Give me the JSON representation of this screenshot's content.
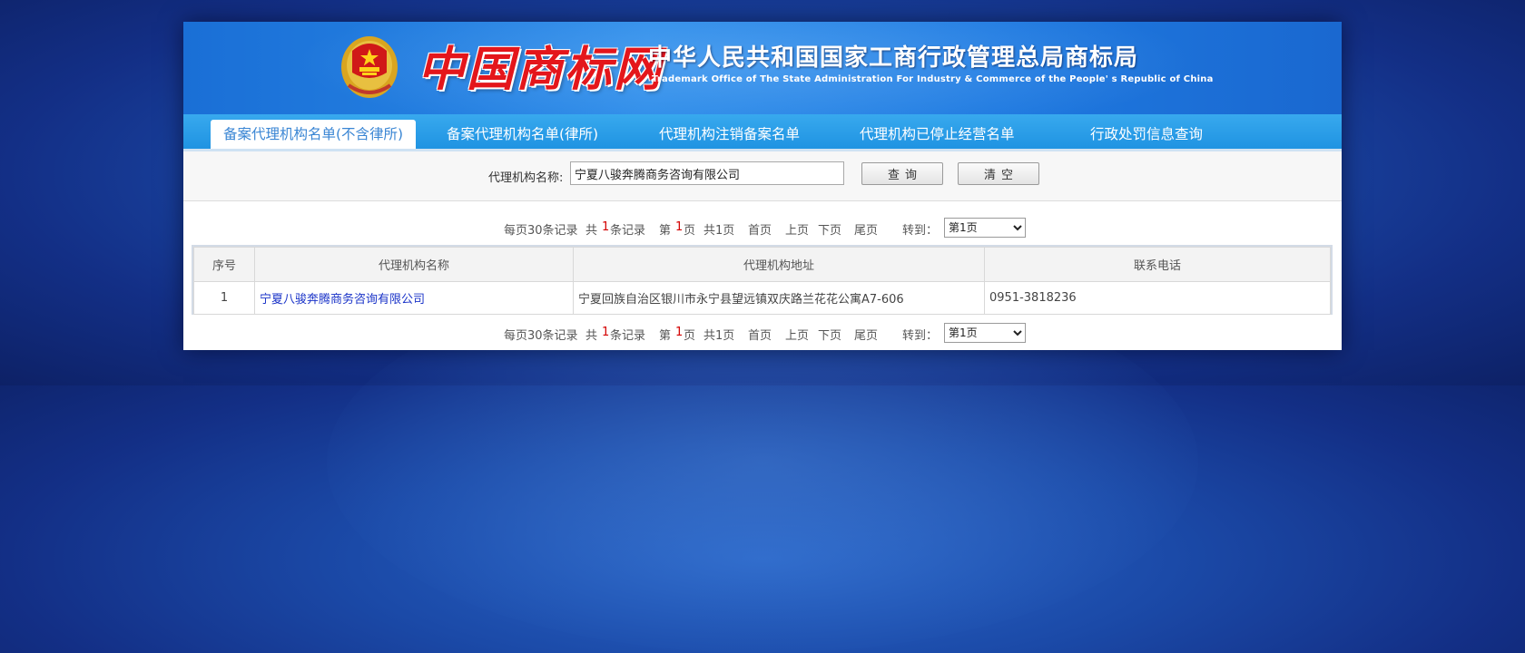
{
  "header": {
    "logo_text": "中国商标网",
    "agency_cn": "中华人民共和国国家工商行政管理总局商标局",
    "agency_en": "Trademark Office of The State Administration For Industry & Commerce of the People' s Republic of China"
  },
  "nav": {
    "tabs": [
      {
        "label": "备案代理机构名单(不含律所)",
        "active": true
      },
      {
        "label": "备案代理机构名单(律所)",
        "active": false
      },
      {
        "label": "代理机构注销备案名单",
        "active": false
      },
      {
        "label": "代理机构已停止经营名单",
        "active": false
      },
      {
        "label": "行政处罚信息查询",
        "active": false
      }
    ]
  },
  "search": {
    "label": "代理机构名称:",
    "value": "宁夏八骏奔腾商务咨询有限公司",
    "query_button": "查询",
    "clear_button": "清空"
  },
  "pager": {
    "per_page": "每页30条记录",
    "total_prefix": "共",
    "total_count": "1",
    "total_suffix": "条记录",
    "page_prefix": "第",
    "current_page": "1",
    "page_suffix": "页",
    "total_pages": "共1页",
    "first": "首页",
    "prev": "上页",
    "next": "下页",
    "last": "尾页",
    "goto_label": "转到：",
    "goto_value": "第1页"
  },
  "table": {
    "headers": [
      "序号",
      "代理机构名称",
      "代理机构地址",
      "联系电话"
    ],
    "rows": [
      [
        "1",
        "宁夏八骏奔腾商务咨询有限公司",
        "宁夏回族自治区银川市永宁县望远镇双庆路兰花花公寓A7-606",
        "0951-3818236"
      ]
    ]
  },
  "colors": {
    "banner_blue": "#1e79e0",
    "nav_blue": "#1f93e2",
    "logo_red": "#e4161b",
    "link_blue": "#1a33c8",
    "count_red": "#d40000"
  }
}
